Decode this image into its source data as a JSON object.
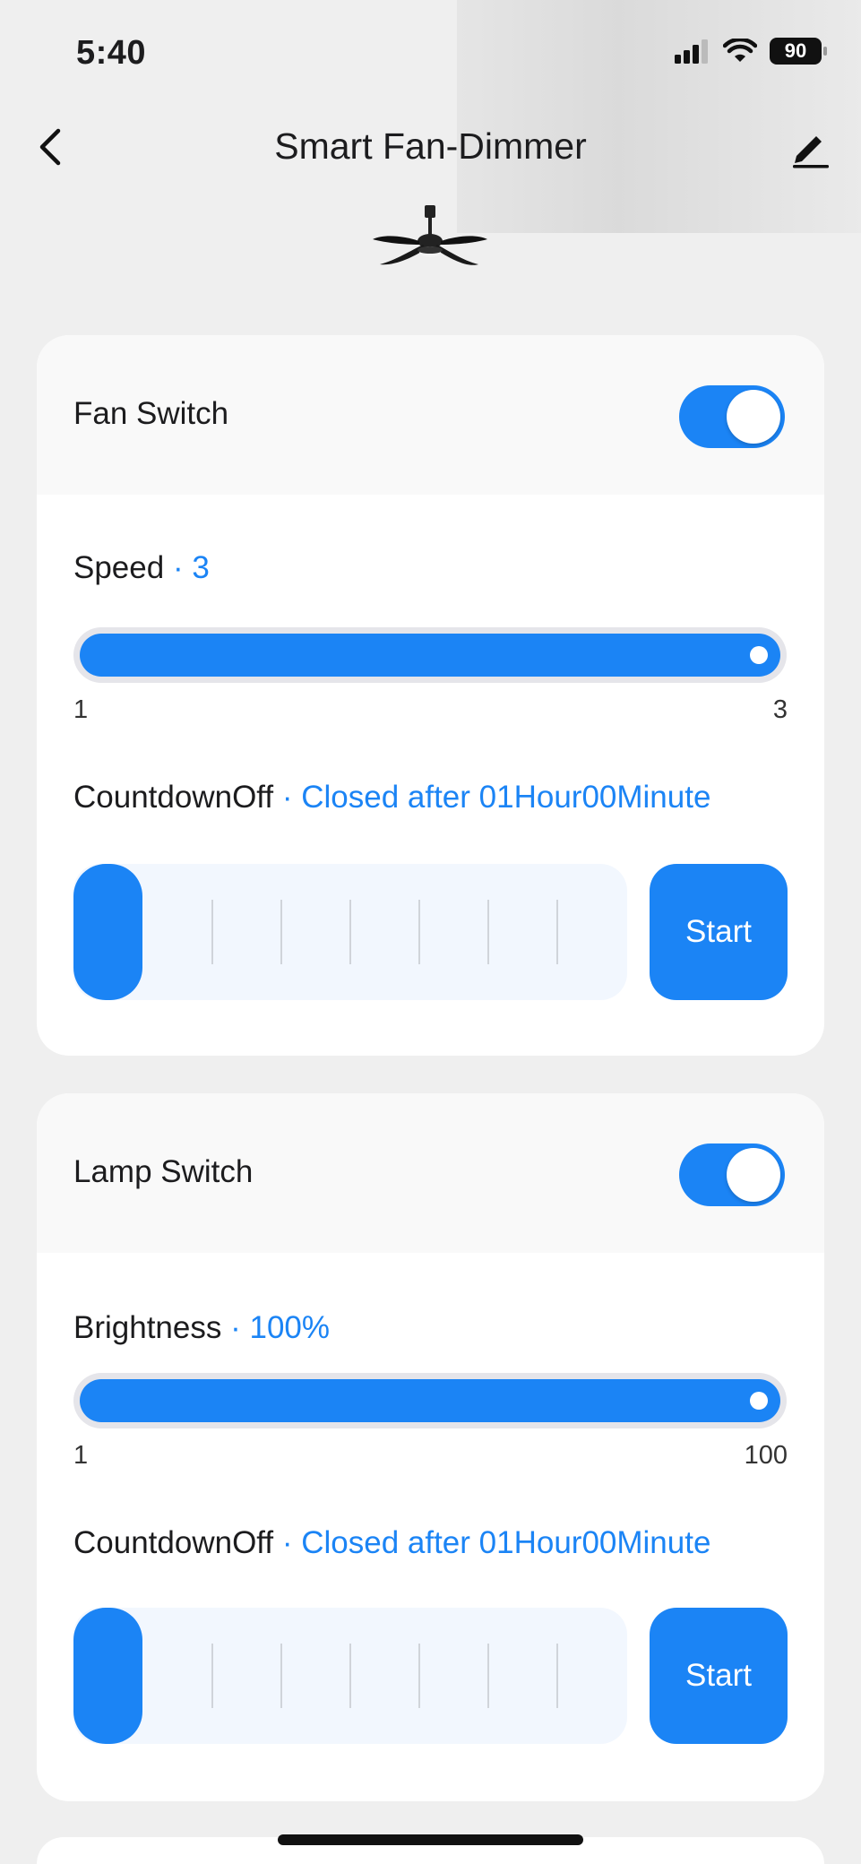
{
  "status_bar": {
    "time": "5:40",
    "battery": "90"
  },
  "nav": {
    "title": "Smart Fan-Dimmer"
  },
  "fan_card": {
    "switch_label": "Fan Switch",
    "switch_on": true,
    "speed_label": "Speed",
    "speed_value": "· 3",
    "speed_min": "1",
    "speed_max": "3",
    "speed_fraction": 1.0,
    "countdown_label": "CountdownOff",
    "countdown_value": "· Closed after 01Hour00Minute",
    "start_label": "Start"
  },
  "lamp_card": {
    "switch_label": "Lamp Switch",
    "switch_on": true,
    "brightness_label": "Brightness",
    "brightness_value": "· 100%",
    "brightness_min": "1",
    "brightness_max": "100",
    "brightness_fraction": 1.0,
    "countdown_label": "CountdownOff",
    "countdown_value": "· Closed after 01Hour00Minute",
    "start_label": "Start"
  },
  "colors": {
    "accent": "#1b84f5",
    "card": "#ffffff",
    "background": "#efefef"
  },
  "icons": [
    "back-chevron-icon",
    "edit-pencil-icon",
    "signal-icon",
    "wifi-icon",
    "battery-icon",
    "ceiling-fan-icon"
  ]
}
